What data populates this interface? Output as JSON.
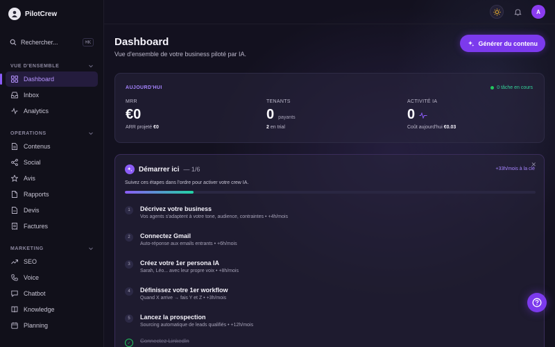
{
  "brand": {
    "name": "PilotCrew"
  },
  "search": {
    "label": "Rechercher...",
    "shortcut": "⌘K"
  },
  "sections": [
    {
      "title": "VUE D'ENSEMBLE",
      "items": [
        {
          "label": "Dashboard",
          "icon": "grid-icon",
          "active": true
        },
        {
          "label": "Inbox",
          "icon": "inbox-icon"
        },
        {
          "label": "Analytics",
          "icon": "activity-icon"
        }
      ]
    },
    {
      "title": "OPERATIONS",
      "items": [
        {
          "label": "Contenus",
          "icon": "document-icon"
        },
        {
          "label": "Social",
          "icon": "share-icon"
        },
        {
          "label": "Avis",
          "icon": "star-icon"
        },
        {
          "label": "Rapports",
          "icon": "file-icon"
        },
        {
          "label": "Devis",
          "icon": "file-text-icon"
        },
        {
          "label": "Factures",
          "icon": "receipt-icon"
        }
      ]
    },
    {
      "title": "MARKETING",
      "items": [
        {
          "label": "SEO",
          "icon": "trending-up-icon"
        },
        {
          "label": "Voice",
          "icon": "phone-icon"
        },
        {
          "label": "Chatbot",
          "icon": "chat-icon"
        },
        {
          "label": "Knowledge",
          "icon": "book-icon"
        },
        {
          "label": "Planning",
          "icon": "calendar-icon"
        }
      ]
    }
  ],
  "header": {
    "title": "Dashboard",
    "subtitle": "Vue d'ensemble de votre business piloté par IA.",
    "generate_label": "Générer du contenu",
    "avatar_initial": "A"
  },
  "today": {
    "label": "AUJOURD'HUI",
    "running": "0 tâche en cours",
    "mrr": {
      "label": "MRR",
      "value": "€0",
      "foot_label": "ARR projeté",
      "foot_value": "€0"
    },
    "tenants": {
      "label": "TENANTS",
      "value": "0",
      "unit": "payants",
      "foot_value": "2",
      "foot_label": "en trial"
    },
    "ai": {
      "label": "ACTIVITÉ IA",
      "value": "0",
      "foot_label": "Coût aujourd'hui",
      "foot_value": "€0.03"
    }
  },
  "start": {
    "title": "Démarrer ici",
    "count": "— 1/6",
    "gain": "+33h/mois à la clé",
    "subtitle": "Suivez ces étapes dans l'ordre pour activer votre crew IA.",
    "progress": 0.167,
    "steps": [
      {
        "num": "1",
        "title": "Décrivez votre business",
        "desc": "Vos agents s'adaptent à votre tone, audience, contraintes • +4h/mois"
      },
      {
        "num": "2",
        "title": "Connectez Gmail",
        "desc": "Auto-réponse aux emails entrants • +6h/mois"
      },
      {
        "num": "3",
        "title": "Créez votre 1er persona IA",
        "desc": "Sarah, Léo... avec leur propre voix • +8h/mois"
      },
      {
        "num": "4",
        "title": "Définissez votre 1er workflow",
        "desc": "Quand X arrive → fais Y et Z • +3h/mois"
      },
      {
        "num": "5",
        "title": "Lancez la prospection",
        "desc": "Sourcing automatique de leads qualifiés • +12h/mois"
      }
    ],
    "done_step": {
      "title": "Connectez LinkedIn"
    }
  },
  "colors": {
    "accent": "#8b5cf6",
    "success": "#22c55e"
  }
}
